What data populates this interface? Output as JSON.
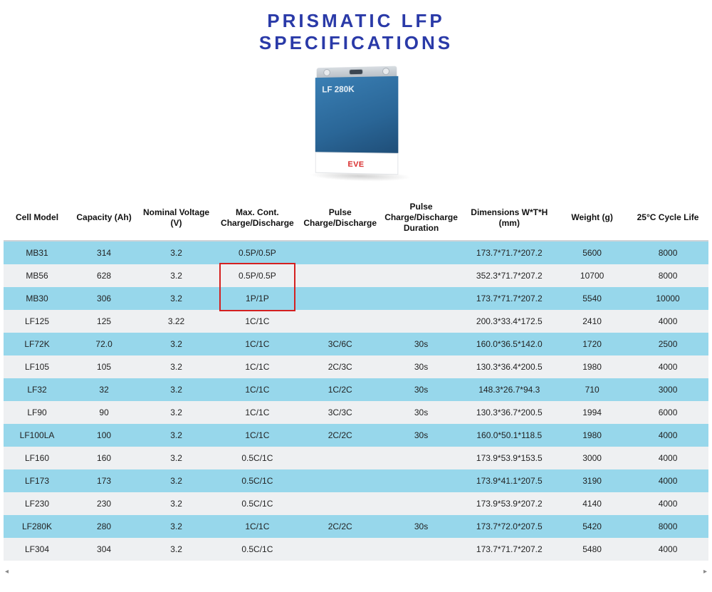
{
  "title_line1": "PRISMATIC LFP",
  "title_line2": "SPECIFICATIONS",
  "battery": {
    "model_text": "LF 280K",
    "brand": "EVE"
  },
  "columns": [
    "Cell Model",
    "Capacity (Ah)",
    "Nominal Voltage (V)",
    "Max. Cont. Charge/Discharge",
    "Pulse Charge/Discharge",
    "Pulse Charge/Discharge Duration",
    "Dimensions W*T*H (mm)",
    "Weight (g)",
    "25°C Cycle Life"
  ],
  "rows": [
    {
      "model": "MB31",
      "capacity": "314",
      "voltage": "3.2",
      "maxcd": "0.5P/0.5P",
      "pulse": "",
      "pdur": "",
      "dim": "173.7*71.7*207.2",
      "weight": "5600",
      "cycle": "8000"
    },
    {
      "model": "MB56",
      "capacity": "628",
      "voltage": "3.2",
      "maxcd": "0.5P/0.5P",
      "pulse": "",
      "pdur": "",
      "dim": "352.3*71.7*207.2",
      "weight": "10700",
      "cycle": "8000"
    },
    {
      "model": "MB30",
      "capacity": "306",
      "voltage": "3.2",
      "maxcd": "1P/1P",
      "pulse": "",
      "pdur": "",
      "dim": "173.7*71.7*207.2",
      "weight": "5540",
      "cycle": "10000"
    },
    {
      "model": "LF125",
      "capacity": "125",
      "voltage": "3.22",
      "maxcd": "1C/1C",
      "pulse": "",
      "pdur": "",
      "dim": "200.3*33.4*172.5",
      "weight": "2410",
      "cycle": "4000"
    },
    {
      "model": "LF72K",
      "capacity": "72.0",
      "voltage": "3.2",
      "maxcd": "1C/1C",
      "pulse": "3C/6C",
      "pdur": "30s",
      "dim": "160.0*36.5*142.0",
      "weight": "1720",
      "cycle": "2500"
    },
    {
      "model": "LF105",
      "capacity": "105",
      "voltage": "3.2",
      "maxcd": "1C/1C",
      "pulse": "2C/3C",
      "pdur": "30s",
      "dim": "130.3*36.4*200.5",
      "weight": "1980",
      "cycle": "4000"
    },
    {
      "model": "LF32",
      "capacity": "32",
      "voltage": "3.2",
      "maxcd": "1C/1C",
      "pulse": "1C/2C",
      "pdur": "30s",
      "dim": "148.3*26.7*94.3",
      "weight": "710",
      "cycle": "3000"
    },
    {
      "model": "LF90",
      "capacity": "90",
      "voltage": "3.2",
      "maxcd": "1C/1C",
      "pulse": "3C/3C",
      "pdur": "30s",
      "dim": "130.3*36.7*200.5",
      "weight": "1994",
      "cycle": "6000"
    },
    {
      "model": "LF100LA",
      "capacity": "100",
      "voltage": "3.2",
      "maxcd": "1C/1C",
      "pulse": "2C/2C",
      "pdur": "30s",
      "dim": "160.0*50.1*118.5",
      "weight": "1980",
      "cycle": "4000"
    },
    {
      "model": "LF160",
      "capacity": "160",
      "voltage": "3.2",
      "maxcd": "0.5C/1C",
      "pulse": "",
      "pdur": "",
      "dim": "173.9*53.9*153.5",
      "weight": "3000",
      "cycle": "4000"
    },
    {
      "model": "LF173",
      "capacity": "173",
      "voltage": "3.2",
      "maxcd": "0.5C/1C",
      "pulse": "",
      "pdur": "",
      "dim": "173.9*41.1*207.5",
      "weight": "3190",
      "cycle": "4000"
    },
    {
      "model": "LF230",
      "capacity": "230",
      "voltage": "3.2",
      "maxcd": "0.5C/1C",
      "pulse": "",
      "pdur": "",
      "dim": "173.9*53.9*207.2",
      "weight": "4140",
      "cycle": "4000"
    },
    {
      "model": "LF280K",
      "capacity": "280",
      "voltage": "3.2",
      "maxcd": "1C/1C",
      "pulse": "2C/2C",
      "pdur": "30s",
      "dim": "173.7*72.0*207.5",
      "weight": "5420",
      "cycle": "8000"
    },
    {
      "model": "LF304",
      "capacity": "304",
      "voltage": "3.2",
      "maxcd": "0.5C/1C",
      "pulse": "",
      "pdur": "",
      "dim": "173.7*71.7*207.2",
      "weight": "5480",
      "cycle": "4000"
    }
  ],
  "highlight": {
    "col": "maxcd",
    "row_start": 1,
    "row_end": 2
  },
  "scroll_hint": {
    "left": "◂",
    "right": "▸"
  }
}
